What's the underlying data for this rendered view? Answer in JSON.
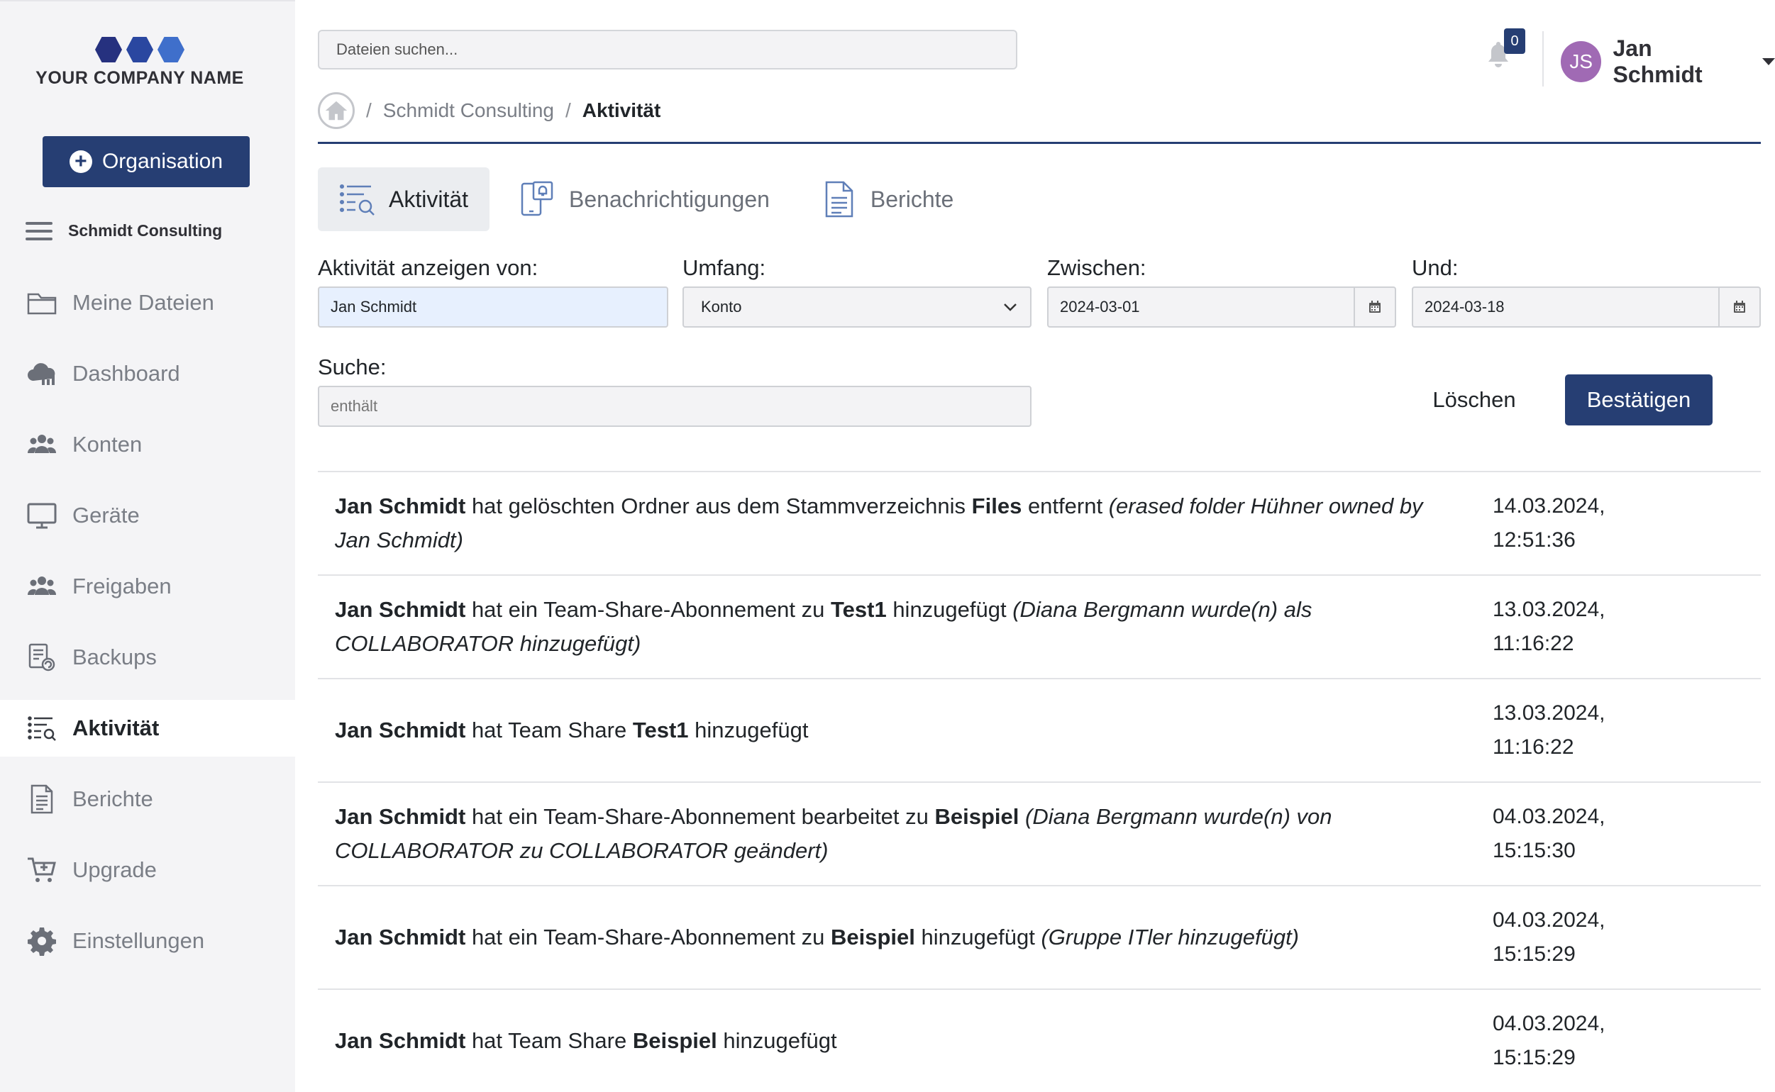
{
  "company": {
    "name": "YOUR COMPANY NAME",
    "hex_colors": [
      "#26317f",
      "#2a47a0",
      "#3f6fcb"
    ]
  },
  "sidebar": {
    "org_button": "Organisation",
    "tenant": "Schmidt Consulting",
    "items": [
      {
        "label": "Meine Dateien",
        "icon": "folder-icon"
      },
      {
        "label": "Dashboard",
        "icon": "cloud-chart-icon"
      },
      {
        "label": "Konten",
        "icon": "users-icon"
      },
      {
        "label": "Geräte",
        "icon": "monitor-icon"
      },
      {
        "label": "Freigaben",
        "icon": "share-users-icon"
      },
      {
        "label": "Backups",
        "icon": "backup-icon"
      },
      {
        "label": "Aktivität",
        "icon": "activity-list-icon",
        "active": true
      },
      {
        "label": "Berichte",
        "icon": "report-icon"
      },
      {
        "label": "Upgrade",
        "icon": "cart-plus-icon"
      },
      {
        "label": "Einstellungen",
        "icon": "gear-icon"
      }
    ]
  },
  "header": {
    "search_placeholder": "Dateien suchen...",
    "notification_count": "0",
    "user_initials": "JS",
    "user_name": "Jan Schmidt"
  },
  "breadcrumb": {
    "sep": "/",
    "parent": "Schmidt Consulting",
    "current": "Aktivität"
  },
  "tabs": [
    {
      "label": "Aktivität",
      "active": true
    },
    {
      "label": "Benachrichtigungen"
    },
    {
      "label": "Berichte"
    }
  ],
  "filters": {
    "show_from_label": "Aktivität anzeigen von:",
    "show_from_value": "Jan Schmidt",
    "scope_label": "Umfang:",
    "scope_value": "Konto",
    "between_label": "Zwischen:",
    "between_value": "2024-03-01",
    "and_label": "Und:",
    "and_value": "2024-03-18",
    "search_label": "Suche:",
    "search_placeholder": "enthält",
    "clear_button": "Löschen",
    "confirm_button": "Bestätigen"
  },
  "activities": [
    {
      "parts": [
        {
          "t": "b",
          "text": "Jan Schmidt"
        },
        {
          "t": "n",
          "text": " hat gelöschten Ordner aus dem Stammverzeichnis "
        },
        {
          "t": "b",
          "text": "Files"
        },
        {
          "t": "n",
          "text": " entfernt "
        },
        {
          "t": "i",
          "text": "(erased folder Hühner owned by Jan Schmidt)"
        }
      ],
      "date": "14.03.2024,",
      "time": "12:51:36"
    },
    {
      "parts": [
        {
          "t": "b",
          "text": "Jan Schmidt"
        },
        {
          "t": "n",
          "text": " hat ein Team-Share-Abonnement zu "
        },
        {
          "t": "b",
          "text": "Test1"
        },
        {
          "t": "n",
          "text": " hinzugefügt "
        },
        {
          "t": "i",
          "text": "(Diana Bergmann wurde(n) als COLLABORATOR hinzugefügt)"
        }
      ],
      "date": "13.03.2024,",
      "time": "11:16:22"
    },
    {
      "parts": [
        {
          "t": "b",
          "text": "Jan Schmidt"
        },
        {
          "t": "n",
          "text": " hat Team Share "
        },
        {
          "t": "b",
          "text": "Test1"
        },
        {
          "t": "n",
          "text": " hinzugefügt"
        }
      ],
      "date": "13.03.2024,",
      "time": "11:16:22"
    },
    {
      "parts": [
        {
          "t": "b",
          "text": "Jan Schmidt"
        },
        {
          "t": "n",
          "text": " hat ein Team-Share-Abonnement bearbeitet zu "
        },
        {
          "t": "b",
          "text": "Beispiel"
        },
        {
          "t": "n",
          "text": " "
        },
        {
          "t": "i",
          "text": "(Diana Bergmann wurde(n) von COLLABORATOR zu COLLABORATOR geändert)"
        }
      ],
      "date": "04.03.2024,",
      "time": "15:15:30"
    },
    {
      "parts": [
        {
          "t": "b",
          "text": "Jan Schmidt"
        },
        {
          "t": "n",
          "text": " hat ein Team-Share-Abonnement zu "
        },
        {
          "t": "b",
          "text": "Beispiel"
        },
        {
          "t": "n",
          "text": " hinzugefügt "
        },
        {
          "t": "i",
          "text": "(Gruppe ITler hinzugefügt)"
        }
      ],
      "date": "04.03.2024,",
      "time": "15:15:29"
    },
    {
      "parts": [
        {
          "t": "b",
          "text": "Jan Schmidt"
        },
        {
          "t": "n",
          "text": " hat Team Share "
        },
        {
          "t": "b",
          "text": "Beispiel"
        },
        {
          "t": "n",
          "text": " hinzugefügt"
        }
      ],
      "date": "04.03.2024,",
      "time": "15:15:29"
    }
  ]
}
